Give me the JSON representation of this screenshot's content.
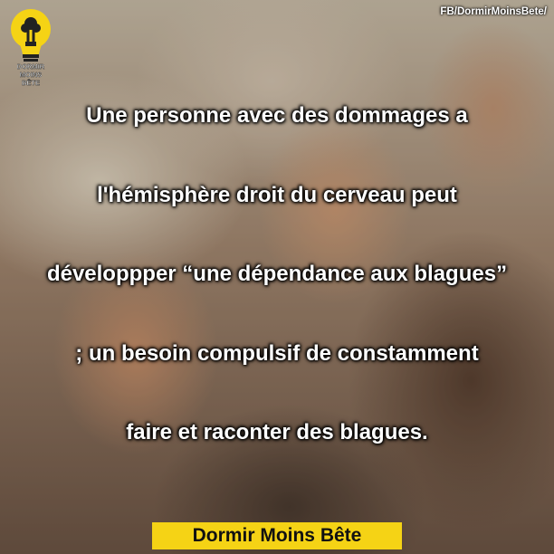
{
  "header": {
    "fb_handle": "FB/DormirMoinsBete/"
  },
  "logo": {
    "line1": "DORMIR",
    "line2": "MOINS",
    "line3": "BÊTE",
    "bulb_color": "#f5d315"
  },
  "fact": {
    "lines": [
      "Une personne avec des dommages a",
      "l'hémisphère droit du cerveau peut",
      "développper “une dépendance aux blagues”",
      "; un besoin compulsif de constamment",
      "faire et raconter des blagues."
    ]
  },
  "footer": {
    "brand": "Dormir Moins Bête",
    "banner_color": "#f5d315"
  }
}
